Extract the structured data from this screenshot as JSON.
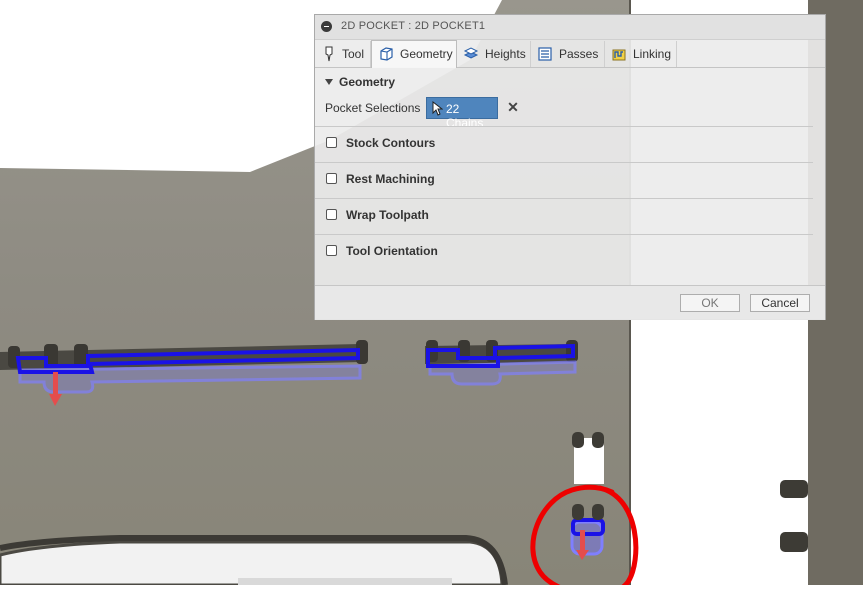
{
  "dialog": {
    "title": "2D POCKET : 2D POCKET1",
    "tabs": [
      {
        "label": "Tool",
        "icon": "tool-icon"
      },
      {
        "label": "Geometry",
        "icon": "geometry-icon",
        "active": true
      },
      {
        "label": "Heights",
        "icon": "heights-icon"
      },
      {
        "label": "Passes",
        "icon": "passes-icon"
      },
      {
        "label": "Linking",
        "icon": "linking-icon"
      }
    ],
    "section_title": "Geometry",
    "pocket_selections_label": "Pocket Selections",
    "pocket_selections_value": "22 Chains",
    "clear_symbol": "✕",
    "options": [
      {
        "label": "Stock Contours",
        "checked": false
      },
      {
        "label": "Rest Machining",
        "checked": false
      },
      {
        "label": "Wrap Toolpath",
        "checked": false
      },
      {
        "label": "Tool Orientation",
        "checked": false
      }
    ],
    "ok_label": "OK",
    "cancel_label": "Cancel"
  },
  "colors": {
    "selection_chain": "#1a12e6",
    "annotation_circle": "#ee0000",
    "chip_background": "#4f85bd",
    "model_surface": "#8f8c82"
  }
}
